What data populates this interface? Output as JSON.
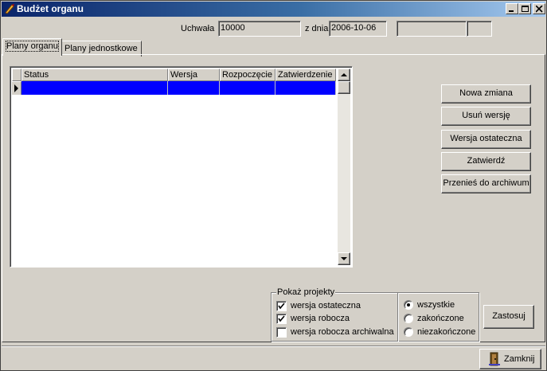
{
  "window": {
    "title": "Budżet organu"
  },
  "header": {
    "resolution_label": "Uchwała",
    "resolution_value": "10000",
    "date_label": "z dnia",
    "date_value": "2006-10-06",
    "extra_value_1": "",
    "extra_value_2": ""
  },
  "tabs": [
    {
      "label": "Plany organu",
      "active": true
    },
    {
      "label": "Plany jednostkowe",
      "active": false
    }
  ],
  "grid": {
    "columns": [
      "Status",
      "Wersja",
      "Rozpoczęcie",
      "Zatwierdzenie"
    ],
    "rows": [
      [
        "",
        "",
        "",
        ""
      ]
    ],
    "selected_row_color": "#0000ff"
  },
  "actions": {
    "new_change": "Nowa zmiana",
    "delete_version": "Usuń wersję",
    "final_version": "Wersja ostateczna",
    "approve": "Zatwierdź",
    "archive": "Przenieś do archiwum"
  },
  "filter": {
    "title": "Pokaż projekty",
    "checkboxes": [
      {
        "label": "wersja ostateczna",
        "checked": true
      },
      {
        "label": "wersja robocza",
        "checked": true
      },
      {
        "label": "wersja robocza archiwalna",
        "checked": false
      }
    ],
    "radios": [
      {
        "label": "wszystkie",
        "selected": true
      },
      {
        "label": "zakończone",
        "selected": false
      },
      {
        "label": "niezakończone",
        "selected": false
      }
    ],
    "apply_label": "Zastosuj"
  },
  "footer": {
    "close_label": "Zamknij"
  }
}
